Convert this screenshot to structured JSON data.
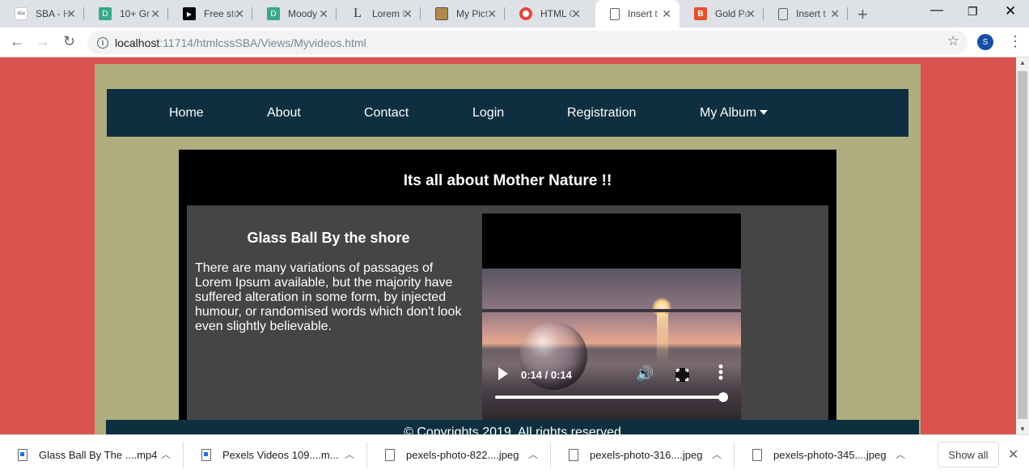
{
  "tabs": [
    {
      "title": "SBA - H",
      "favicon_color": "#ffffff",
      "favicon": "sba"
    },
    {
      "title": "10+ Gr",
      "favicon_color": "#3aa88b",
      "favicon": "D"
    },
    {
      "title": "Free sto",
      "favicon_color": "#000000",
      "favicon": "▶"
    },
    {
      "title": "Moody",
      "favicon_color": "#3aa88b",
      "favicon": "D"
    },
    {
      "title": "Lorem I",
      "favicon_color": "#ffffff",
      "favicon": "L"
    },
    {
      "title": "My Pict",
      "favicon_color": "#b08850",
      "favicon": "img"
    },
    {
      "title": "HTML C",
      "favicon_color": "#e8453c",
      "favicon": "○"
    },
    {
      "title": "Insert t",
      "favicon_color": "#ffffff",
      "favicon": "doc"
    },
    {
      "title": "Gold Pa",
      "favicon_color": "#e2522e",
      "favicon": "B"
    },
    {
      "title": "Insert t",
      "favicon_color": "#ffffff",
      "favicon": "doc"
    }
  ],
  "url": {
    "host": "localhost",
    "path": ":11714/htmlcssSBA/Views/Myvideos.html"
  },
  "profile_initial": "S",
  "site": {
    "nav": [
      "Home",
      "About",
      "Contact",
      "Login",
      "Registration",
      "My Album"
    ],
    "heading": "Its all about Mother Nature !!",
    "card_title": "Glass Ball By the shore",
    "card_text": "There are many variations of passages of Lorem Ipsum available, but the majority have suffered alteration in some form, by injected humour, or randomised words which don't look even slightly believable.",
    "video_time": "0:14 / 0:14",
    "video_progress": 1.0,
    "footer": "© Copyrights 2019, All rights reserved"
  },
  "downloads": [
    {
      "name": "Glass Ball By The ....mp4",
      "type": "media"
    },
    {
      "name": "Pexels Videos 109....m...",
      "type": "media"
    },
    {
      "name": "pexels-photo-822....jpeg",
      "type": "file"
    },
    {
      "name": "pexels-photo-316....jpeg",
      "type": "file"
    },
    {
      "name": "pexels-photo-345....jpeg",
      "type": "file"
    }
  ],
  "show_all_label": "Show all",
  "colors": {
    "page_bg": "#d9534f",
    "container": "#b0ad7e",
    "navbar": "#0e2f3f",
    "card": "#454545"
  }
}
